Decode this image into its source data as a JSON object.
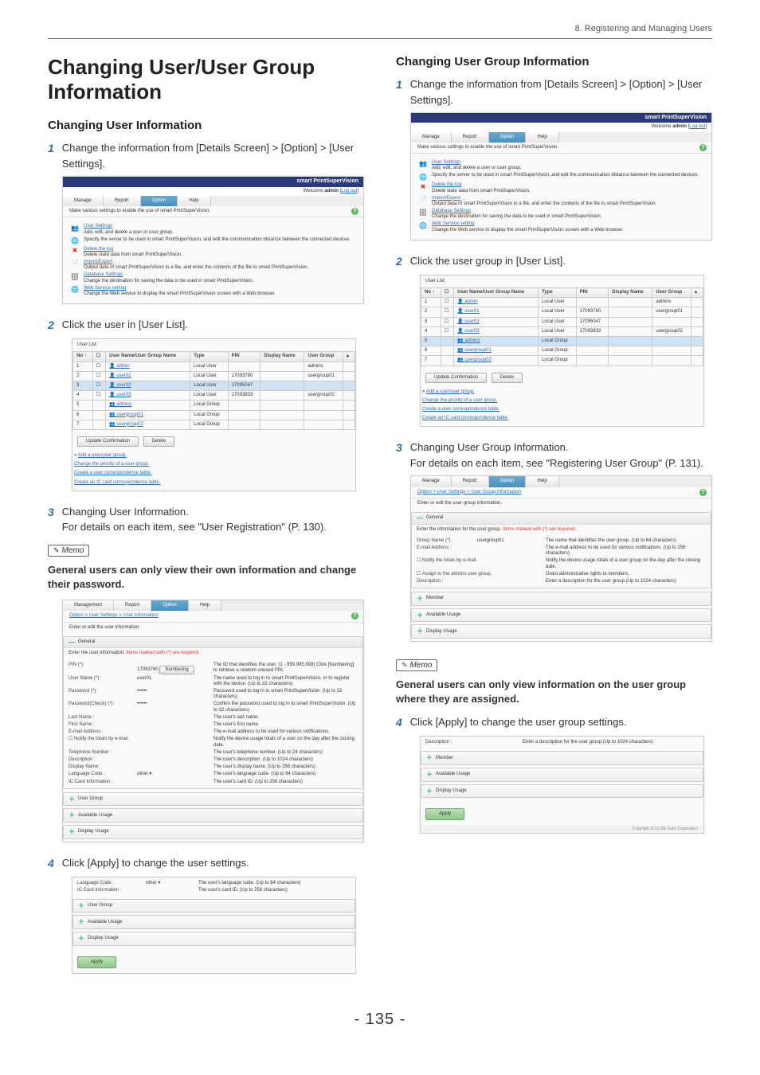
{
  "header": "8. Registering and Managing Users",
  "page_number": "- 135 -",
  "left": {
    "h1": "Changing User/User Group Information",
    "h2": "Changing User Information",
    "steps": {
      "s1": "Change the information from [Details Screen] > [Option] > [User Settings].",
      "s2": "Click the user in [User List].",
      "s3a": "Changing User Information.",
      "s3b": "For details on each item, see \"User Registration\" (P. 130).",
      "s4": "Click [Apply] to change the user settings."
    },
    "memo": {
      "label": "Memo",
      "text": "General users can only view their own information and change their password."
    }
  },
  "right": {
    "h2": "Changing User Group Information",
    "steps": {
      "s1": "Change the information from [Details Screen] > [Option] > [User Settings].",
      "s2": "Click the user group in [User List].",
      "s3a": "Changing User Group Information.",
      "s3b": "For details on each item, see \"Registering User Group\" (P. 131).",
      "s4": "Click [Apply] to change the user group settings."
    },
    "memo": {
      "label": "Memo",
      "text": "General users can only view information on the user group where they are assigned."
    }
  },
  "spv": {
    "brand": "smart PrintSuperVision",
    "welcome_pre": "Welcome ",
    "welcome_user": "admin",
    "logout": "Log out",
    "tabs": {
      "manage": "Manage",
      "report": "Report",
      "option": "Option",
      "help": "Help"
    },
    "subbar": "Make various settings to enable the use of smart PrintSuperVision.",
    "menu": {
      "user_settings": "User Settings",
      "user_settings_desc": "Add, edit, and delete a user or user group.",
      "server_desc": "Specify the server to be used in smart PrintSuperVision, and edit the communication distance between the connected devices.",
      "delete_log": "Delete the log",
      "delete_log_desc": "Delete state data from smart PrintSuperVision.",
      "import_export": "Import/Export",
      "import_export_desc": "Output data of smart PrintSuperVision to a file, and enter the contents of the file to smart PrintSuperVision.",
      "db_settings": "Database Settings",
      "db_settings_desc": "Change the destination for saving the data to be used in smart PrintSuperVision.",
      "web_service": "Web Service setting",
      "web_service_desc": "Change the Web service to display the smart PrintSuperVision screen with a Web browser."
    },
    "userlist": {
      "title": "User List:",
      "cols": {
        "no": "No ↑",
        "name": "User Name/User Group Name",
        "type": "Type",
        "pin": "PIN",
        "display": "Display Name",
        "group": "User Group"
      },
      "rows": [
        {
          "no": "1",
          "name": "admin",
          "type": "Local User",
          "pin": "",
          "group": "admins"
        },
        {
          "no": "2",
          "name": "user01",
          "type": "Local User",
          "pin": "17093760",
          "group": "usergroup01"
        },
        {
          "no": "3",
          "name": "user02",
          "type": "Local User",
          "pin": "17095047",
          "group": ""
        },
        {
          "no": "4",
          "name": "user03",
          "type": "Local User",
          "pin": "17093833",
          "group": "usergroup02"
        },
        {
          "no": "5",
          "name": "admins",
          "type": "Local Group",
          "pin": "",
          "group": ""
        },
        {
          "no": "6",
          "name": "usergroup01",
          "type": "Local Group",
          "pin": "",
          "group": ""
        },
        {
          "no": "7",
          "name": "usergroup02",
          "type": "Local Group",
          "pin": "",
          "group": ""
        }
      ],
      "btn_update": "Update Confirmation",
      "btn_delete": "Delete",
      "add_link": "Add a user/user group.",
      "change_priority": "Change the priority of a user group.",
      "create_user_table": "Create a user correspondence table.",
      "create_ic_table": "Create an IC card correspondence table."
    },
    "userinfo": {
      "breadcrumb": "Option > User Settings > User Information",
      "intro": "Enter or edit the user information.",
      "general": "General",
      "required": "Enter the user information. Items marked with (*) are required.",
      "rows": {
        "pin": {
          "lab": "PIN (*):",
          "val": "17093760",
          "btn": "Numbering",
          "desc": "The ID that identifies the user. (1 - 999,995,999)\nClick [Numbering] to retrieve a random unused PIN."
        },
        "uname": {
          "lab": "User Name (*):",
          "val": "user01",
          "desc": "The name used to log in to smart PrintSuperVision, or to register with the device. (Up to 32 characters)"
        },
        "pw": {
          "lab": "Password (*):",
          "val": "••••••",
          "desc": "Password used to log in to smart PrintSuperVision. (Up to 32 characters)"
        },
        "pwc": {
          "lab": "Password(Check) (*):",
          "val": "••••••",
          "desc": "Confirm the password used to log in to smart PrintSuperVision. (Up to 32 characters)"
        },
        "last": {
          "lab": "Last Name :",
          "desc": "The user's last name."
        },
        "first": {
          "lab": "First Name :",
          "desc": "The user's first name."
        },
        "email": {
          "lab": "E-mail Address :",
          "desc": "The e-mail address to be used for various notifications."
        },
        "notify": {
          "lab": "☐ Notify the totals by e-mail.",
          "desc": "Notify the device usage totals of a user on the day after the closing date."
        },
        "tel": {
          "lab": "Telephone Number :",
          "desc": "The user's telephone number. (Up to 24 characters)"
        },
        "descr": {
          "lab": "Description :",
          "desc": "The user's description. (Up to 1024 characters)"
        },
        "disp": {
          "lab": "Display Name :",
          "desc": "The user's display name. (Up to 256 characters)"
        },
        "lang": {
          "lab": "Language Code :",
          "val": "other",
          "desc": "The user's language code. (Up to 64 characters)"
        },
        "card": {
          "lab": "IC Card Information :",
          "desc": "The user's card ID. (Up to 256 characters)"
        }
      },
      "panels": {
        "usergroup": "User Group",
        "available": "Available Usage",
        "display_usage": "Display Usage"
      }
    },
    "apply_panel": {
      "lang": {
        "lab": "Language Code :",
        "val": "other",
        "desc": "The user's language code. (Up to 64 characters)"
      },
      "card": {
        "lab": "IC Card Information :",
        "desc": "The user's card ID. (Up to 256 characters)"
      },
      "apply": "Apply"
    },
    "groupinfo": {
      "breadcrumb": "Option > User Settings > User Group Information",
      "intro": "Enter or edit the user group information.",
      "required": "Enter the information for the user group. Items marked with (*) are required.",
      "rows": {
        "gname": {
          "lab": "Group Name (*):",
          "val": "usergroup01",
          "desc": "The name that identifies the user group. (Up to 64 characters)"
        },
        "email": {
          "lab": "E-mail Address :",
          "desc": "The e-mail address to be used for various notifications. (Up to 256 characters)"
        },
        "notify": {
          "lab": "☐ Notify the totals by e-mail.",
          "desc": "Notify the device usage totals of a user group on the day after the closing date."
        },
        "assign": {
          "lab": "☐ Assign to the admins user group.",
          "desc": "Grant administrative rights to members."
        },
        "descr": {
          "lab": "Description :",
          "desc": "Enter a description for the user group.(Up to 1024 characters)"
        }
      },
      "panels": {
        "member": "Member",
        "available": "Available Usage",
        "display_usage": "Display Usage"
      }
    },
    "group_apply": {
      "descr_lab": "Description :",
      "descr_desc": "Enter a description for the user group.(Up to 1024 characters)",
      "member": "Member",
      "available": "Available Usage",
      "display_usage": "Display Usage",
      "apply": "Apply",
      "copyright": "Copyright 2013 Oki Data Corporation."
    }
  }
}
